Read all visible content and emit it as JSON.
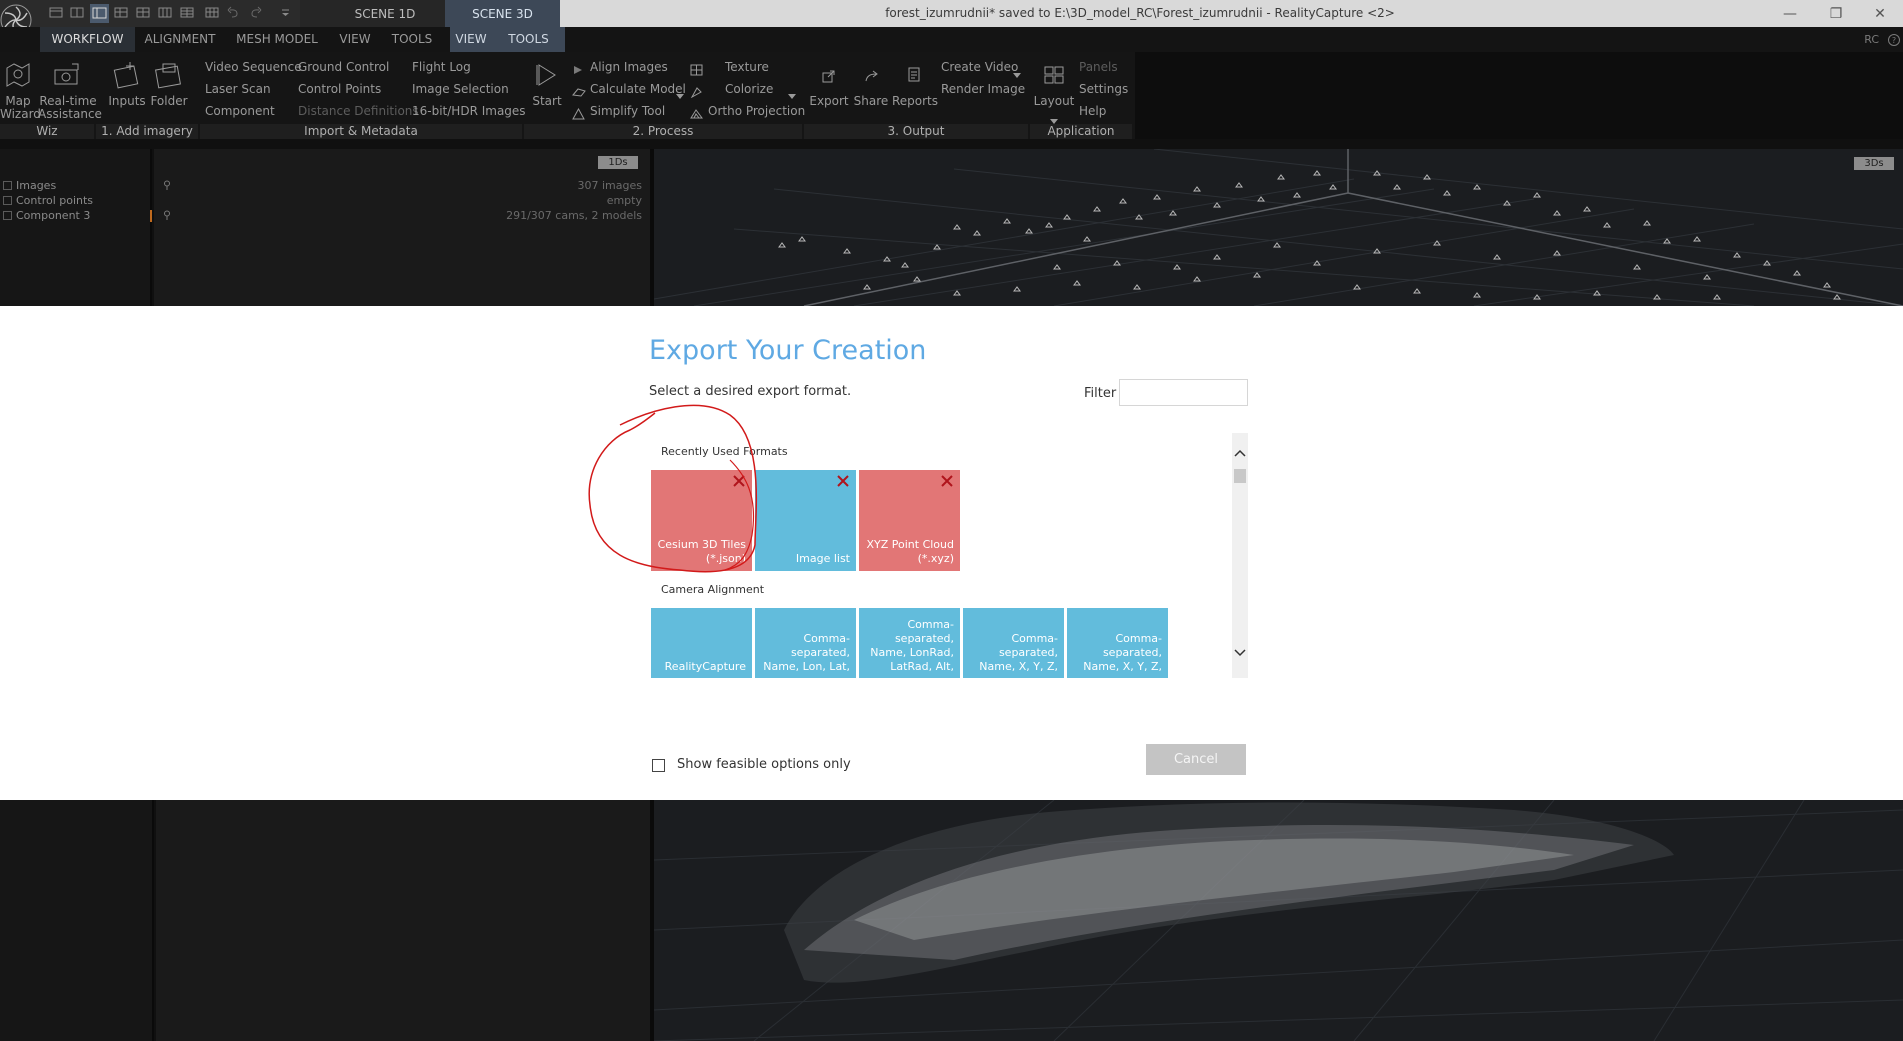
{
  "window": {
    "title": "forest_izumrudnii* saved to E:\\3D_model_RC\\Forest_izumrudnii - RealityCapture <2>",
    "scene_tabs": [
      "SCENE 1D",
      "SCENE 3D"
    ],
    "badge": "RC"
  },
  "menu": {
    "tabs": [
      "WORKFLOW",
      "ALIGNMENT",
      "MESH MODEL",
      "VIEW",
      "TOOLS",
      "VIEW",
      "TOOLS"
    ]
  },
  "ribbon": {
    "wiz": {
      "map": "Map\nWizard",
      "realtime": "Real-time\nAssistance",
      "footer": "Wiz"
    },
    "add_imagery": {
      "inputs": "Inputs",
      "folder": "Folder",
      "footer": "1. Add imagery"
    },
    "import": {
      "items": [
        "Video Sequence",
        "Laser Scan",
        "Component",
        "Ground Control",
        "Control Points",
        "Distance Definitions",
        "Flight Log",
        "Image Selection",
        "16-bit/HDR Images"
      ],
      "footer": "Import & Metadata"
    },
    "process": {
      "start": "Start",
      "items": [
        "Align Images",
        "Calculate Model",
        "Simplify Tool",
        "Texture",
        "Colorize",
        "Ortho Projection"
      ],
      "footer": "2. Process"
    },
    "output": {
      "items": [
        "Export",
        "Share",
        "Reports",
        "Create Video",
        "Render Image"
      ],
      "footer": "3. Output"
    },
    "application": {
      "layout": "Layout",
      "items": [
        "Panels",
        "Settings",
        "Help"
      ],
      "footer": "Application"
    }
  },
  "tree": {
    "tab": "1Ds",
    "rows": [
      {
        "label": "Images",
        "value": "307 images"
      },
      {
        "label": "Control points",
        "value": "empty"
      },
      {
        "label": "Component 3",
        "value": "291/307 cams, 2 models"
      }
    ]
  },
  "view3d": {
    "tab": "3Ds"
  },
  "dialog": {
    "title": "Export Your Creation",
    "subtitle": "Select a desired export format.",
    "filter_label": "Filter",
    "filter_value": "",
    "sections": [
      {
        "title": "Recently Used Formats",
        "tiles": [
          {
            "label": "Cesium 3D Tiles\n(*.json)",
            "color": "#e27676",
            "closable": true
          },
          {
            "label": "Image list",
            "color": "#62bcdc",
            "closable": true
          },
          {
            "label": "XYZ Point Cloud\n(*.xyz)",
            "color": "#e27676",
            "closable": true
          }
        ]
      },
      {
        "title": "Camera Alignment",
        "tiles": [
          {
            "label": "RealityCapture",
            "color": "#62bcdc",
            "closable": false
          },
          {
            "label": "Comma-\nseparated,\nName, Lon, Lat,",
            "color": "#62bcdc",
            "closable": false
          },
          {
            "label": "Comma-\nseparated,\nName, LonRad,\nLatRad, Alt,",
            "color": "#62bcdc",
            "closable": false
          },
          {
            "label": "Comma-\nseparated,\nName, X, Y, Z,",
            "color": "#62bcdc",
            "closable": false
          },
          {
            "label": "Comma-\nseparated,\nName, X, Y, Z,",
            "color": "#62bcdc",
            "closable": false
          }
        ]
      }
    ],
    "feasible_label": "Show feasible options only",
    "feasible_checked": false,
    "cancel_label": "Cancel"
  },
  "colors": {
    "accent_title": "#5fa9e3",
    "tile_red": "#e27676",
    "tile_blue": "#62bcdc",
    "annotation": "#d21a1a"
  }
}
